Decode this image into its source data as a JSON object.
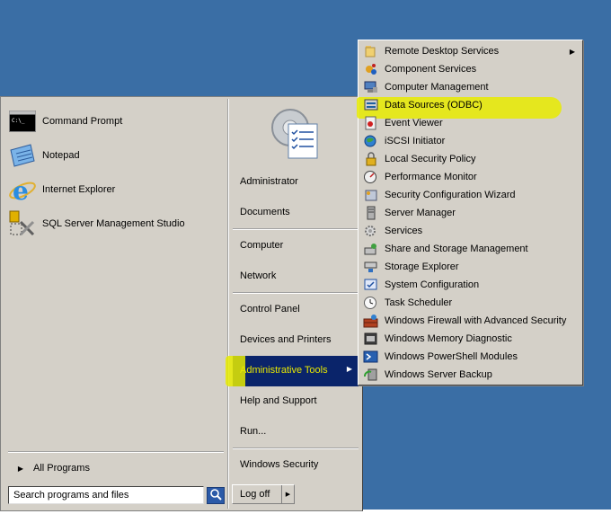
{
  "colors": {
    "desktop": "#3a6ea5",
    "menu_bg": "#d4d0c8",
    "selection": "#0a246a",
    "highlighter": "#e8eb00"
  },
  "start_menu": {
    "pinned": [
      {
        "label": "Command Prompt",
        "icon": "command-prompt-icon"
      },
      {
        "label": "Notepad",
        "icon": "notepad-icon"
      },
      {
        "label": "Internet Explorer",
        "icon": "internet-explorer-icon"
      },
      {
        "label": "SQL Server Management Studio",
        "icon": "sql-server-icon"
      }
    ],
    "all_programs": "All Programs",
    "search_placeholder": "Search programs and files",
    "right": {
      "user": "Administrator",
      "documents": "Documents",
      "computer": "Computer",
      "network": "Network",
      "control_panel": "Control Panel",
      "devices": "Devices and Printers",
      "admin_tools": "Administrative Tools",
      "help": "Help and Support",
      "run": "Run...",
      "windows_security": "Windows Security",
      "log_off": "Log off"
    }
  },
  "submenu": {
    "items": [
      {
        "label": "Remote Desktop Services",
        "icon": "folder-icon",
        "has_submenu": true
      },
      {
        "label": "Component Services",
        "icon": "component-services-icon"
      },
      {
        "label": "Computer Management",
        "icon": "computer-management-icon"
      },
      {
        "label": "Data Sources (ODBC)",
        "icon": "odbc-icon",
        "highlighted": true
      },
      {
        "label": "Event Viewer",
        "icon": "event-viewer-icon"
      },
      {
        "label": "iSCSI Initiator",
        "icon": "iscsi-icon"
      },
      {
        "label": "Local Security Policy",
        "icon": "security-policy-icon"
      },
      {
        "label": "Performance Monitor",
        "icon": "performance-monitor-icon"
      },
      {
        "label": "Security Configuration Wizard",
        "icon": "security-wizard-icon"
      },
      {
        "label": "Server Manager",
        "icon": "server-manager-icon"
      },
      {
        "label": "Services",
        "icon": "services-icon"
      },
      {
        "label": "Share and Storage Management",
        "icon": "share-storage-icon"
      },
      {
        "label": "Storage Explorer",
        "icon": "storage-explorer-icon"
      },
      {
        "label": "System Configuration",
        "icon": "system-configuration-icon"
      },
      {
        "label": "Task Scheduler",
        "icon": "task-scheduler-icon"
      },
      {
        "label": "Windows Firewall with Advanced Security",
        "icon": "firewall-icon"
      },
      {
        "label": "Windows Memory Diagnostic",
        "icon": "memory-diagnostic-icon"
      },
      {
        "label": "Windows PowerShell Modules",
        "icon": "powershell-icon"
      },
      {
        "label": "Windows Server Backup",
        "icon": "server-backup-icon"
      }
    ]
  }
}
